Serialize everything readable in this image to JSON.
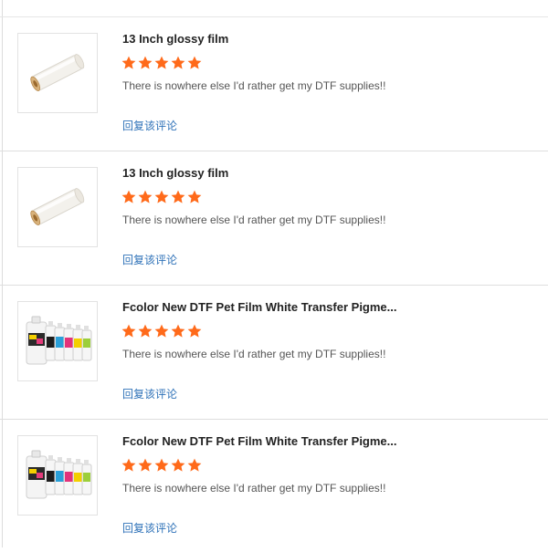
{
  "reviews": [
    {
      "product_title": "13 Inch glossy film",
      "rating": 5,
      "rating_max": 5,
      "comment": "There is nowhere else I'd rather get my DTF supplies!!",
      "reply_label": "回复该评论",
      "image_icon": "film-roll-icon"
    },
    {
      "product_title": "13 Inch glossy film",
      "rating": 5,
      "rating_max": 5,
      "comment": "There is nowhere else I'd rather get my DTF supplies!!",
      "reply_label": "回复该评论",
      "image_icon": "film-roll-icon"
    },
    {
      "product_title": "Fcolor New DTF Pet Film White Transfer Pigme...",
      "rating": 5,
      "rating_max": 5,
      "comment": "There is nowhere else I'd rather get my DTF supplies!!",
      "reply_label": "回复该评论",
      "image_icon": "ink-bottles-icon"
    },
    {
      "product_title": "Fcolor New DTF Pet Film White Transfer Pigme...",
      "rating": 5,
      "rating_max": 5,
      "comment": "There is nowhere else I'd rather get my DTF supplies!!",
      "reply_label": "回复该评论",
      "image_icon": "ink-bottles-icon"
    }
  ],
  "colors": {
    "star": "#ff6a1a",
    "reply_link": "#2f72b8",
    "divider": "#dedede"
  }
}
